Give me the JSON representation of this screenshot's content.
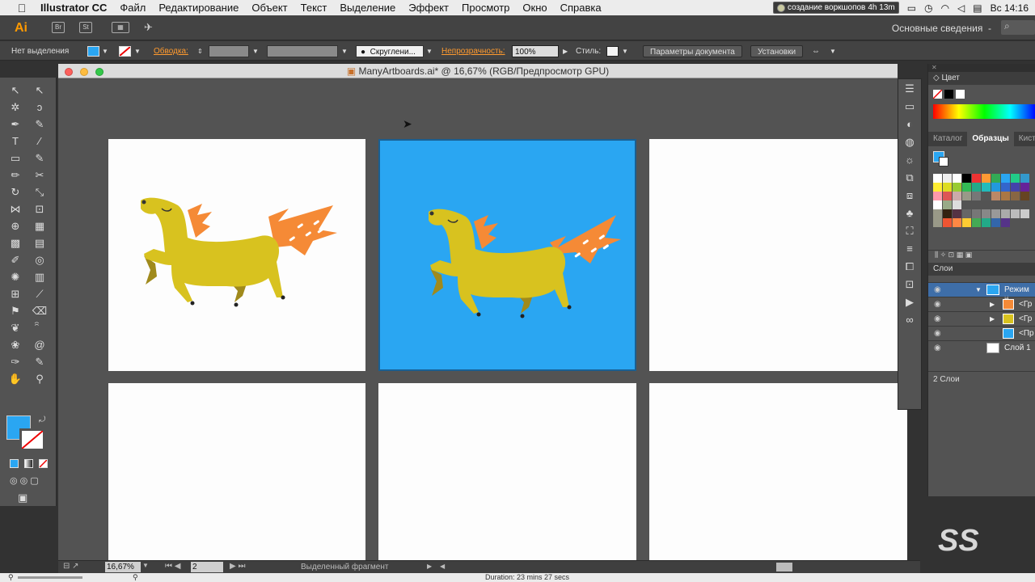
{
  "menubar": {
    "apple": "",
    "app": "Illustrator CC",
    "items": [
      "Файл",
      "Редактирование",
      "Объект",
      "Текст",
      "Выделение",
      "Эффект",
      "Просмотр",
      "Окно",
      "Справка"
    ],
    "recording": "создание воркшопов",
    "rec_time": "4h 13m",
    "clock": "Вс 14:16"
  },
  "appbar": {
    "logo": "Ai",
    "btn1": "Br",
    "btn2": "St",
    "workspace": "Основные сведения",
    "workspace_arrow": "-"
  },
  "control": {
    "selection": "Нет выделения",
    "stroke_label": "Обводка:",
    "stroke_style": "Скруглени...",
    "opacity_label": "Непрозрачность:",
    "opacity_value": "100%",
    "style_label": "Стиль:",
    "doc_params": "Параметры документа",
    "settings": "Установки"
  },
  "document": {
    "title": "ManyArtboards.ai* @ 16,67% (RGB/Предпросмотр GPU)"
  },
  "canvas": {
    "artboard_bg": "#2aa6f2",
    "horse_body": "#d8c21f",
    "horse_mane": "#f58a36",
    "horse_leg": "#a08a1c"
  },
  "status": {
    "zoom": "16,67%",
    "artboard_num": "2",
    "tool_hint": "Выделенный фрагмент",
    "duration": "Duration: 23 mins 27 secs"
  },
  "panels": {
    "color_title": "Цвет",
    "tab_catalog": "Каталог",
    "tab_swatches": "Образцы",
    "tab_brushes": "Кисти",
    "layers_title": "Слои",
    "layers": [
      {
        "name": "Режим и"
      },
      {
        "name": "<Гр"
      },
      {
        "name": "<Гр"
      },
      {
        "name": "<Пр"
      },
      {
        "name": "Слой 1"
      }
    ],
    "layers_count": "2 Слои"
  },
  "watermark": "SS",
  "fill_color": "#2aa6f2"
}
